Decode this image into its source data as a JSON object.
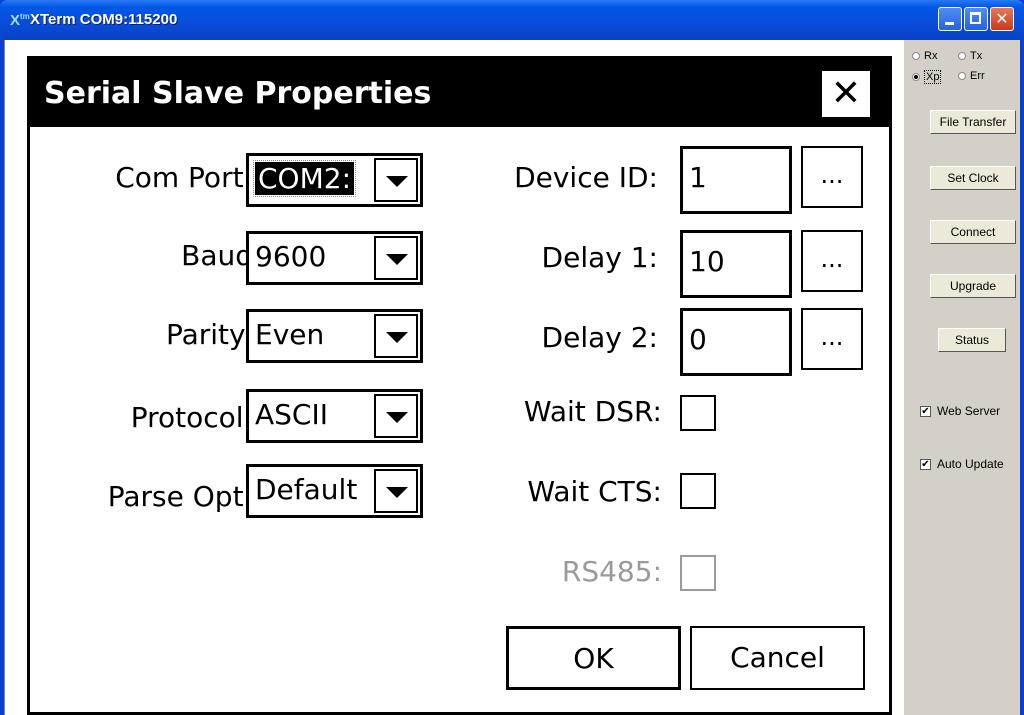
{
  "window": {
    "title": "XTerm COM9:115200",
    "icon_glyph": "X",
    "icon_sup": "tm"
  },
  "right_panel": {
    "radios": [
      {
        "label": "Rx",
        "selected": false
      },
      {
        "label": "Tx",
        "selected": false
      },
      {
        "label": "Xp",
        "selected": true
      },
      {
        "label": "Err",
        "selected": false
      }
    ],
    "buttons": [
      "File Transfer",
      "Set Clock",
      "Connect",
      "Upgrade",
      "Status"
    ],
    "checks": [
      {
        "label": "Web Server",
        "checked": true,
        "mark": "✔"
      },
      {
        "label": "Auto Update",
        "checked": true,
        "mark": "✔"
      }
    ]
  },
  "dialog": {
    "title": "Serial Slave Properties",
    "close_glyph": "✕",
    "fields_left": [
      {
        "label": "Com Port:",
        "value": "COM2:"
      },
      {
        "label": "Baud",
        "value": "9600"
      },
      {
        "label": "Parity:",
        "value": "Even"
      },
      {
        "label": "Protocol:",
        "value": "ASCII"
      },
      {
        "label": "Parse Opt:",
        "value": "Default"
      }
    ],
    "fields_right": [
      {
        "label": "Device ID:",
        "value": "1",
        "button": "..."
      },
      {
        "label": "Delay 1:",
        "value": "10",
        "button": "..."
      },
      {
        "label": "Delay 2:",
        "value": "0",
        "button": "..."
      }
    ],
    "checkboxes": [
      {
        "label": "Wait DSR:",
        "checked": false,
        "enabled": true
      },
      {
        "label": "Wait CTS:",
        "checked": false,
        "enabled": true
      },
      {
        "label": "RS485:",
        "checked": false,
        "enabled": false
      }
    ],
    "ok_label": "OK",
    "cancel_label": "Cancel"
  }
}
